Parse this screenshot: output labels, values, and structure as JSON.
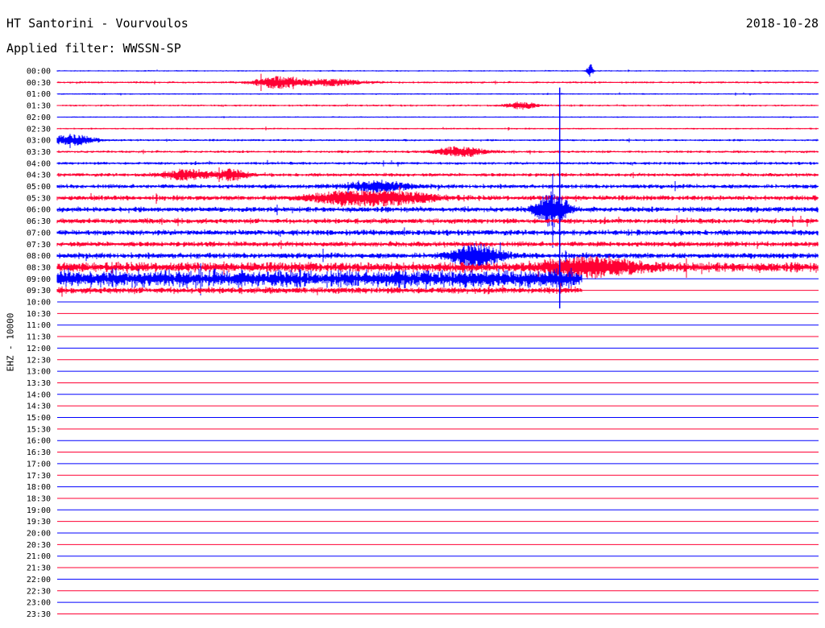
{
  "header": {
    "station": "HT Santorini - Vourvoulos",
    "date": "2018-10-28",
    "filter": "Applied filter: WWSSN-SP"
  },
  "chart_data": {
    "type": "line",
    "title": "HT Santorini - Vourvoulos",
    "ylabel": "EHZ - 10000",
    "xlabel": "",
    "row_labels": [
      "00:00",
      "00:30",
      "01:00",
      "01:30",
      "02:00",
      "02:30",
      "03:00",
      "03:30",
      "04:00",
      "04:30",
      "05:00",
      "05:30",
      "06:00",
      "06:30",
      "07:00",
      "07:30",
      "08:00",
      "08:30",
      "09:00",
      "09:30",
      "10:00",
      "10:30",
      "11:00",
      "11:30",
      "12:00",
      "12:30",
      "13:00",
      "13:30",
      "14:00",
      "14:30",
      "15:00",
      "15:30",
      "16:00",
      "16:30",
      "17:00",
      "17:30",
      "18:00",
      "18:30",
      "19:00",
      "19:30",
      "20:00",
      "20:30",
      "21:00",
      "21:30",
      "22:00",
      "22:30",
      "23:00",
      "23:30"
    ],
    "series_colors": [
      "#0000ff",
      "#ff0033"
    ],
    "trace_extent": [
      1,
      1,
      1,
      1,
      1,
      1,
      1,
      1,
      1,
      1,
      1,
      1,
      1,
      1,
      1,
      1,
      1,
      1,
      0.69,
      0.69,
      0,
      0,
      0,
      0,
      0,
      0,
      0,
      0,
      0,
      0,
      0,
      0,
      0,
      0,
      0,
      0,
      0,
      0,
      0,
      0,
      0,
      0,
      0,
      0,
      0,
      0,
      0,
      0
    ],
    "noise_level": [
      0.9,
      1.3,
      0.9,
      1.2,
      0.8,
      1.0,
      1.3,
      1.6,
      1.8,
      2.2,
      2.6,
      3.0,
      3.3,
      3.2,
      3.4,
      3.2,
      3.5,
      6.0,
      11.0,
      4.0,
      0,
      0,
      0,
      0,
      0,
      0,
      0,
      0,
      0,
      0,
      0,
      0,
      0,
      0,
      0,
      0,
      0,
      0,
      0,
      0,
      0,
      0,
      0,
      0,
      0,
      0,
      0,
      0
    ],
    "events": [
      {
        "row": 0,
        "at": 0.7,
        "amp": 8,
        "width": 0.004
      },
      {
        "row": 1,
        "at": 0.29,
        "amp": 7,
        "width": 0.03
      },
      {
        "row": 1,
        "at": 0.36,
        "amp": 4,
        "width": 0.04
      },
      {
        "row": 3,
        "at": 0.61,
        "amp": 4,
        "width": 0.02
      },
      {
        "row": 6,
        "at": 0.02,
        "amp": 6,
        "width": 0.03
      },
      {
        "row": 7,
        "at": 0.53,
        "amp": 6,
        "width": 0.03
      },
      {
        "row": 9,
        "at": 0.17,
        "amp": 6,
        "width": 0.03
      },
      {
        "row": 9,
        "at": 0.23,
        "amp": 6,
        "width": 0.02
      },
      {
        "row": 10,
        "at": 0.42,
        "amp": 6,
        "width": 0.04
      },
      {
        "row": 11,
        "at": 0.38,
        "amp": 7,
        "width": 0.05
      },
      {
        "row": 11,
        "at": 0.45,
        "amp": 6,
        "width": 0.05
      },
      {
        "row": 12,
        "at": 0.65,
        "amp": 20,
        "width": 0.02
      },
      {
        "row": 16,
        "at": 0.55,
        "amp": 14,
        "width": 0.03
      },
      {
        "row": 17,
        "at": 0.7,
        "amp": 10,
        "width": 0.06
      }
    ],
    "spike": {
      "at": 0.66,
      "row_from": 2,
      "row_to": 20
    }
  }
}
